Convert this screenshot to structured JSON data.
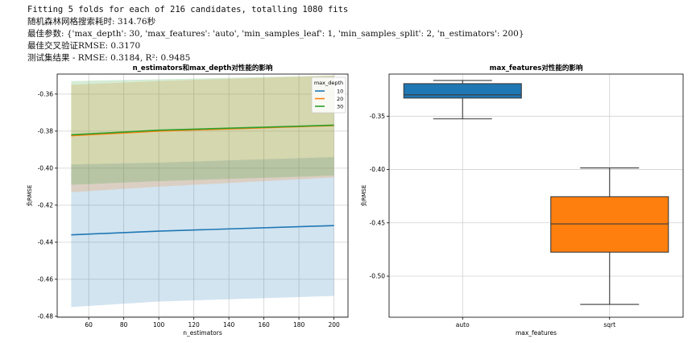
{
  "console": {
    "lines": [
      "Fitting 5 folds for each of 216 candidates, totalling 1080 fits",
      "随机森林网格搜索耗时: 314.76秒",
      "最佳参数: {'max_depth': 30, 'max_features': 'auto', 'min_samples_leaf': 1, 'min_samples_split': 2, 'n_estimators': 200}",
      "最佳交叉验证RMSE: 0.3170",
      "测试集结果 - RMSE: 0.3184, R²: 0.9485"
    ]
  },
  "colors": {
    "blue": "#1f77b4",
    "orange": "#ff7f0e",
    "green": "#2ca02c",
    "grid": "#d0d0d0",
    "box_line": "#3b3b3b"
  },
  "chart_data": [
    {
      "type": "line",
      "title": "n_estimators和max_depth对性能的影响",
      "xlabel": "n_estimators",
      "ylabel": "负RMSE",
      "x": [
        50,
        100,
        200
      ],
      "xticks": [
        60,
        80,
        100,
        120,
        140,
        160,
        180,
        200
      ],
      "yticks": [
        -0.36,
        -0.38,
        -0.4,
        -0.42,
        -0.44,
        -0.46,
        -0.48
      ],
      "ytick_labels": [
        "-0.36",
        "-0.38",
        "-0.40",
        "-0.42",
        "-0.44",
        "-0.46",
        "-0.48"
      ],
      "xlim": [
        42,
        208
      ],
      "ylim": [
        -0.4805,
        -0.3492
      ],
      "grid": true,
      "legend": {
        "title": "max_depth",
        "placement": "top-right"
      },
      "series": [
        {
          "name": "10",
          "color": "#1f77b4",
          "values": [
            -0.436,
            -0.434,
            -0.431
          ],
          "lower": [
            -0.475,
            -0.472,
            -0.469
          ],
          "upper": [
            -0.398,
            -0.397,
            -0.394
          ]
        },
        {
          "name": "20",
          "color": "#ff7f0e",
          "values": [
            -0.3825,
            -0.38,
            -0.377
          ],
          "lower": [
            -0.413,
            -0.41,
            -0.405
          ],
          "upper": [
            -0.355,
            -0.353,
            -0.35
          ]
        },
        {
          "name": "30",
          "color": "#2ca02c",
          "values": [
            -0.382,
            -0.3795,
            -0.3768
          ],
          "lower": [
            -0.409,
            -0.407,
            -0.404
          ],
          "upper": [
            -0.353,
            -0.352,
            -0.35
          ]
        }
      ]
    },
    {
      "type": "box",
      "title": "max_features对性能的影响",
      "xlabel": "max_features",
      "ylabel": "负RMSE",
      "categories": [
        "auto",
        "sqrt"
      ],
      "yticks": [
        -0.35,
        -0.4,
        -0.45,
        -0.5
      ],
      "ytick_labels": [
        "-0.35",
        "-0.40",
        "-0.45",
        "-0.50"
      ],
      "ylim": [
        -0.5385,
        -0.3105
      ],
      "grid": true,
      "boxes": [
        {
          "category": "auto",
          "color": "#1f77b4",
          "whisker_low": -0.3525,
          "q1": -0.333,
          "median": -0.33,
          "q3": -0.3195,
          "whisker_high": -0.3165
        },
        {
          "category": "sqrt",
          "color": "#ff7f0e",
          "whisker_low": -0.5265,
          "q1": -0.4775,
          "median": -0.451,
          "q3": -0.4255,
          "whisker_high": -0.3985
        }
      ]
    }
  ]
}
